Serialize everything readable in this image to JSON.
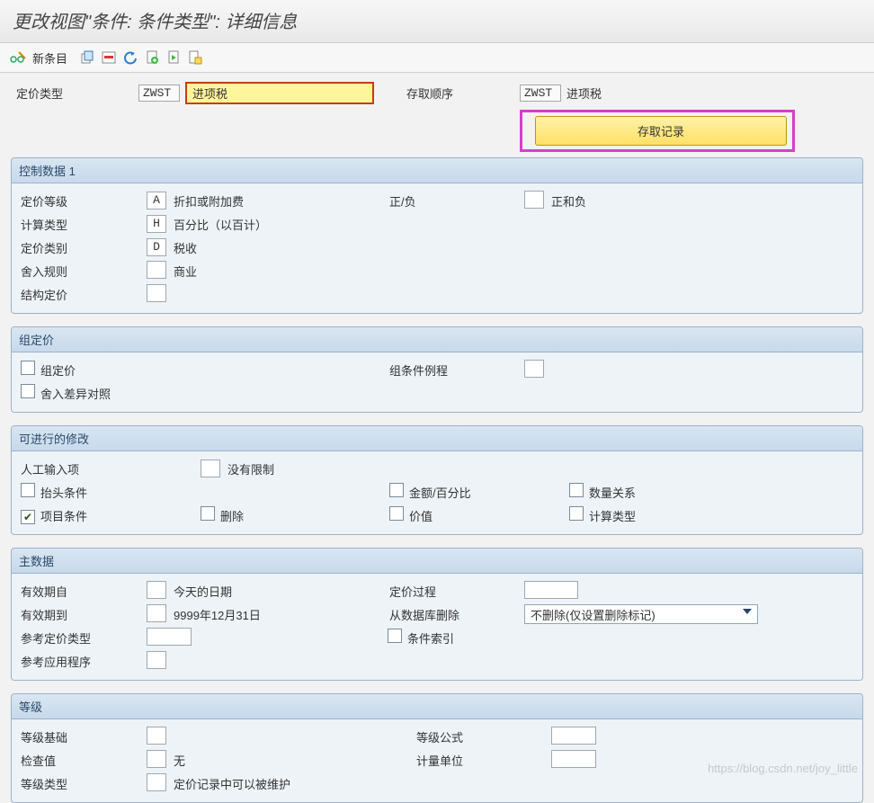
{
  "title": "更改视图\"条件: 条件类型\": 详细信息",
  "toolbar": {
    "new_entry": "新条目"
  },
  "top": {
    "pricing_type_lbl": "定价类型",
    "pricing_type_code": "ZWST",
    "pricing_type_desc": "进项税",
    "access_seq_lbl": "存取顺序",
    "access_seq_code": "ZWST",
    "access_seq_desc": "进项税",
    "access_record_btn": "存取记录"
  },
  "panel1": {
    "title": "控制数据 1",
    "pricing_level_lbl": "定价等级",
    "pricing_level_code": "A",
    "pricing_level_txt": "折扣或附加费",
    "posneg_lbl": "正/负",
    "posneg_txt": "正和负",
    "calc_type_lbl": "计算类型",
    "calc_type_code": "H",
    "calc_type_txt": "百分比（以百计）",
    "pricing_cat_lbl": "定价类别",
    "pricing_cat_code": "D",
    "pricing_cat_txt": "税收",
    "rounding_lbl": "舍入规则",
    "rounding_txt": "商业",
    "struct_lbl": "结构定价"
  },
  "panel2": {
    "title": "组定价",
    "group_pricing": "组定价",
    "group_cond_routine": "组条件例程",
    "round_diff": "舍入差异对照"
  },
  "panel3": {
    "title": "可进行的修改",
    "manual_lbl": "人工输入项",
    "no_limit": "没有限制",
    "header_cond": "抬头条件",
    "amount_pct": "金额/百分比",
    "qty_rel": "数量关系",
    "item_cond": "项目条件",
    "delete": "删除",
    "value": "价值",
    "calc_type": "计算类型"
  },
  "panel4": {
    "title": "主数据",
    "valid_from_lbl": "有效期自",
    "valid_from_txt": "今天的日期",
    "pricing_proc_lbl": "定价过程",
    "valid_to_lbl": "有效期到",
    "valid_to_txt": "9999年12月31日",
    "del_db_lbl": "从数据库删除",
    "del_db_val": "不删除(仅设置删除标记)",
    "ref_type_lbl": "参考定价类型",
    "cond_index": "条件索引",
    "ref_app_lbl": "参考应用程序"
  },
  "panel5": {
    "title": "等级",
    "scale_base_lbl": "等级基础",
    "scale_formula_lbl": "等级公式",
    "check_val_lbl": "检查值",
    "check_val_txt": "无",
    "uom_lbl": "计量单位",
    "scale_type_lbl": "等级类型",
    "scale_type_txt": "定价记录中可以被维护"
  },
  "watermark": "https://blog.csdn.net/joy_little"
}
